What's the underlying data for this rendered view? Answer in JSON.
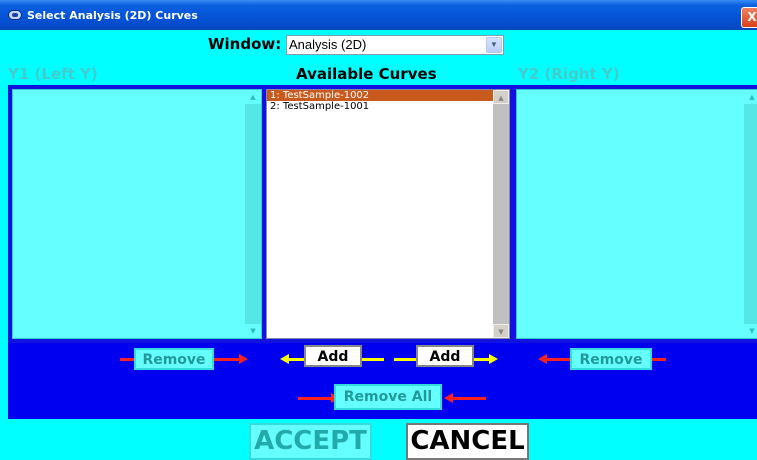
{
  "window": {
    "title": "Select Analysis (2D) Curves",
    "close_label": "X"
  },
  "selector": {
    "label": "Window:",
    "value": "Analysis (2D)"
  },
  "columns": {
    "y1_header": "Y1 (Left Y)",
    "available_header": "Available Curves",
    "y2_header": "Y2 (Right Y)"
  },
  "available_curves": [
    {
      "label": "1: TestSample-1002",
      "selected": true
    },
    {
      "label": "2: TestSample-1001",
      "selected": false
    }
  ],
  "y1_curves": [],
  "y2_curves": [],
  "actions": {
    "remove_left": "Remove",
    "add_left": "Add",
    "add_right": "Add",
    "remove_right": "Remove",
    "remove_all": "Remove All",
    "accept": "ACCEPT",
    "cancel": "CANCEL"
  },
  "colors": {
    "background": "#00FFFF",
    "panel_frame": "#1212E0",
    "selection": "#C85A1E",
    "disabled_button": "#66FFFF",
    "arrow_red": "#FF2020",
    "arrow_yellow": "#FFFF00"
  }
}
